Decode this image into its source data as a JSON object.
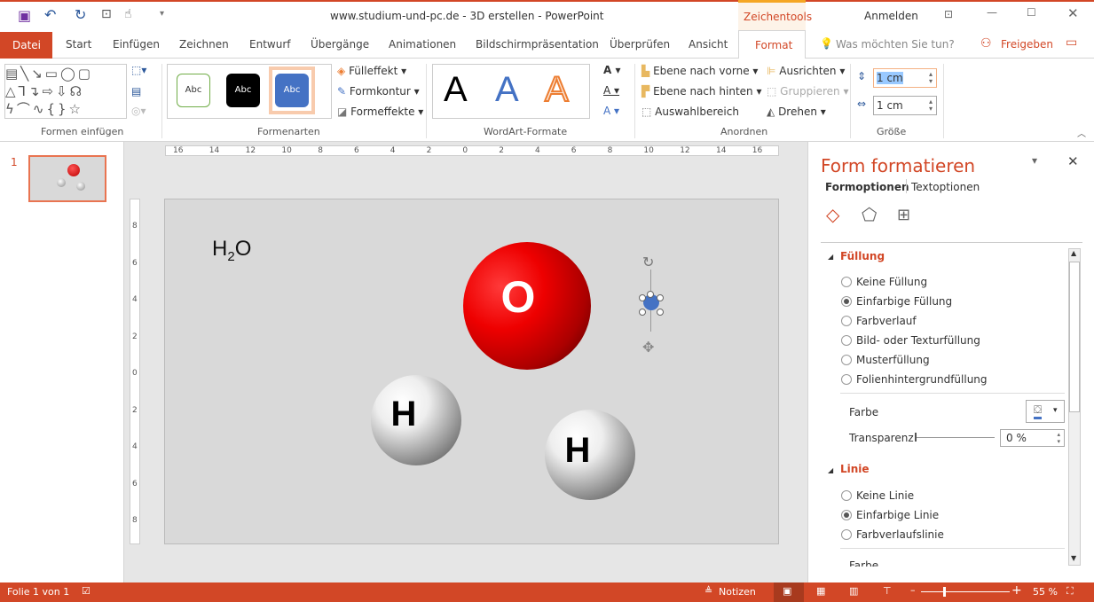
{
  "window": {
    "title": "www.studium-und-pc.de - 3D erstellen  -  PowerPoint",
    "context_tab": "Zeichentools",
    "signin": "Anmelden",
    "accent": "#d24726"
  },
  "tabs": [
    "Datei",
    "Start",
    "Einfügen",
    "Zeichnen",
    "Entwurf",
    "Übergänge",
    "Animationen",
    "Bildschirmpräsentation",
    "Überprüfen",
    "Ansicht",
    "Format"
  ],
  "active_tab": "Format",
  "tell_me": "Was möchten Sie tun?",
  "share": "Freigeben",
  "ribbon": {
    "groups": [
      "Formen einfügen",
      "Formenarten",
      "WordArt-Formate",
      "Anordnen",
      "Größe"
    ],
    "style_samples": [
      "Abc",
      "Abc",
      "Abc"
    ],
    "fill": "Fülleffekt",
    "outline": "Formkontur",
    "effects": "Formeffekte",
    "wordart_samples": [
      "A",
      "A",
      "A"
    ],
    "bring_forward": "Ebene nach vorne",
    "send_backward": "Ebene nach hinten",
    "selection_pane": "Auswahlbereich",
    "align": "Ausrichten",
    "group": "Gruppieren",
    "rotate": "Drehen",
    "height": "1 cm",
    "width": "1 cm"
  },
  "thumbnails": [
    {
      "number": "1"
    }
  ],
  "ruler": {
    "h": [
      "16",
      "14",
      "12",
      "10",
      "8",
      "6",
      "4",
      "2",
      "0",
      "2",
      "4",
      "6",
      "8",
      "10",
      "12",
      "14",
      "16"
    ],
    "v": [
      "8",
      "6",
      "4",
      "2",
      "0",
      "2",
      "4",
      "6",
      "8"
    ]
  },
  "slide": {
    "formula_main": "H",
    "formula_sub": "2",
    "formula_end": "O",
    "atoms": [
      "O",
      "H",
      "H"
    ]
  },
  "pane": {
    "title": "Form formatieren",
    "tab_shape": "Formoptionen",
    "tab_text": "Textoptionen",
    "fill_section": "Füllung",
    "fill_options": [
      {
        "label": "Keine Füllung",
        "checked": false
      },
      {
        "label": "Einfarbige Füllung",
        "checked": true
      },
      {
        "label": "Farbverlauf",
        "checked": false
      },
      {
        "label": "Bild- oder Texturfüllung",
        "checked": false
      },
      {
        "label": "Musterfüllung",
        "checked": false
      },
      {
        "label": "Folienhintergrundfüllung",
        "checked": false
      }
    ],
    "color_label": "Farbe",
    "transparency_label": "Transparenz",
    "transparency_value": "0 %",
    "line_section": "Linie",
    "line_options": [
      {
        "label": "Keine Linie",
        "checked": false
      },
      {
        "label": "Einfarbige Linie",
        "checked": true
      },
      {
        "label": "Farbverlaufslinie",
        "checked": false
      }
    ],
    "line_color_label": "Farbe"
  },
  "status": {
    "slide": "Folie 1 von 1",
    "notes": "Notizen",
    "zoom": "55 %",
    "zoom_percent": 55
  }
}
